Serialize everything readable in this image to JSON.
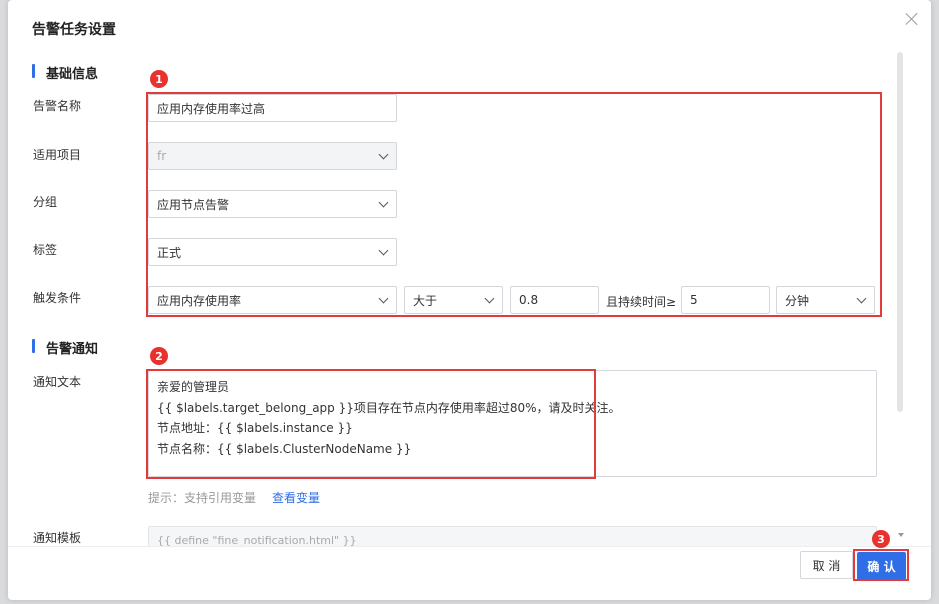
{
  "dialog": {
    "title": "告警任务设置"
  },
  "sections": {
    "basic": "基础信息",
    "notify": "告警通知"
  },
  "fields": {
    "name": {
      "label": "告警名称",
      "value": "应用内存使用率过高"
    },
    "project": {
      "label": "适用项目",
      "value": "fr"
    },
    "group": {
      "label": "分组",
      "value": "应用节点告警"
    },
    "tag": {
      "label": "标签",
      "value": "正式"
    },
    "trigger": {
      "label": "触发条件",
      "metric": "应用内存使用率",
      "operator": "大于",
      "threshold": "0.8",
      "duration_label": "且持续时间≥",
      "duration": "5",
      "unit": "分钟"
    },
    "notify_text": {
      "label": "通知文本",
      "lines": [
        "亲爱的管理员",
        "{{ $labels.target_belong_app }}项目存在节点内存使用率超过80%，请及时关注。",
        "节点地址：{{ $labels.instance }}",
        "节点名称：{{ $labels.ClusterNodeName }}"
      ]
    },
    "hint": {
      "text": "提示：支持引用变量",
      "link": "查看变量"
    },
    "template": {
      "label": "通知模板",
      "value": "{{ define \"fine_notification.html\" }}"
    }
  },
  "buttons": {
    "cancel": "取 消",
    "confirm": "确 认"
  },
  "annotations": {
    "badge1": "1",
    "badge2": "2",
    "badge3": "3",
    "color": "#e23b3b"
  }
}
